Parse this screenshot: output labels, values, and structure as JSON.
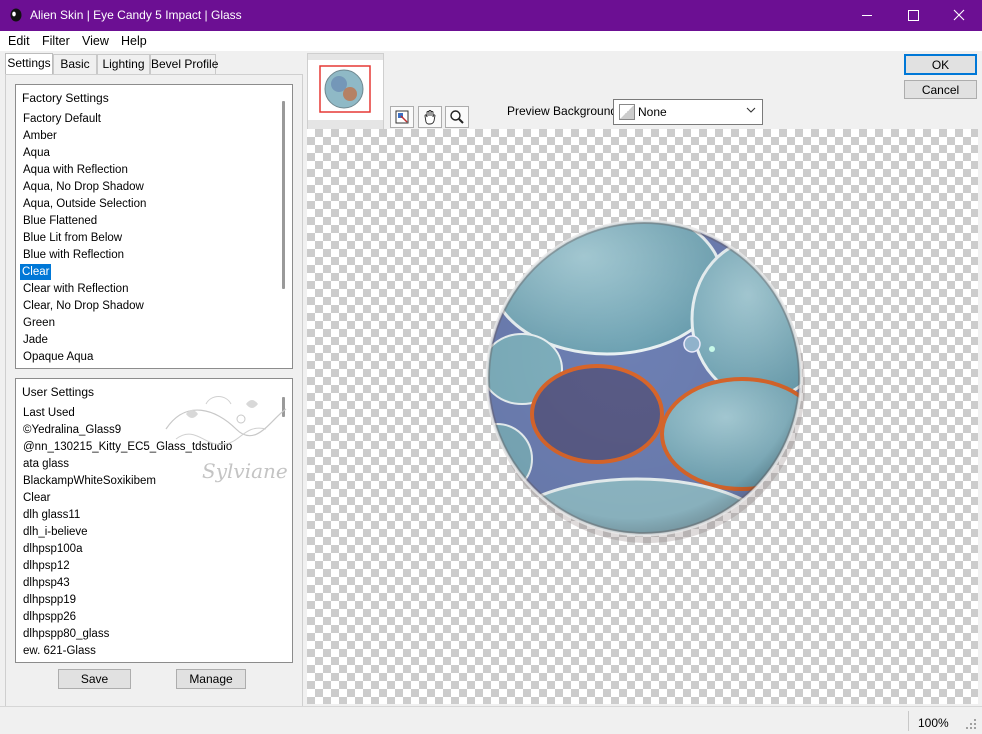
{
  "window": {
    "title": "Alien Skin | Eye Candy 5 Impact | Glass",
    "titlebar_color": "#6c0f93",
    "controls": [
      "minimize-icon",
      "maximize-icon",
      "close-icon"
    ]
  },
  "menu": [
    "Edit",
    "Filter",
    "View",
    "Help"
  ],
  "tabs": [
    "Settings",
    "Basic",
    "Lighting",
    "Bevel Profile"
  ],
  "factory_settings": {
    "header": "Factory Settings",
    "items": [
      "Factory Default",
      "Amber",
      "Aqua",
      "Aqua with Reflection",
      "Aqua, No Drop Shadow",
      "Aqua, Outside Selection",
      "Blue Flattened",
      "Blue Lit from Below",
      "Blue with Reflection",
      "Clear",
      "Clear with Reflection",
      "Clear, No Drop Shadow",
      "Green",
      "Jade",
      "Opaque Aqua"
    ],
    "selected": "Clear"
  },
  "user_settings": {
    "header": "User Settings",
    "items": [
      "Last Used",
      "©Yedralina_Glass9",
      "@nn_130215_Kitty_EC5_Glass_tdstudio",
      "ata glass",
      "BlackampWhiteSoxikibem",
      "Clear",
      "dlh glass11",
      "dlh_i-believe",
      "dlhpsp100a",
      "dlhpsp12",
      "dlhpsp43",
      "dlhpspp19",
      "dlhpspp26",
      "dlhpspp80_glass",
      "ew. 621-Glass"
    ]
  },
  "watermark": "Sylviane",
  "buttons": {
    "save": "Save",
    "manage": "Manage",
    "ok": "OK",
    "cancel": "Cancel"
  },
  "preview": {
    "background_label": "Preview Background:",
    "background_value": "None",
    "tools": [
      "navigator-icon",
      "hand-icon",
      "zoom-icon"
    ]
  },
  "status": {
    "zoom": "100%"
  },
  "colors": {
    "accent": "#0078d7",
    "glass_teal": "#7fb6c4",
    "glass_orange": "#d8642a",
    "glass_purple": "#5b5f88"
  }
}
